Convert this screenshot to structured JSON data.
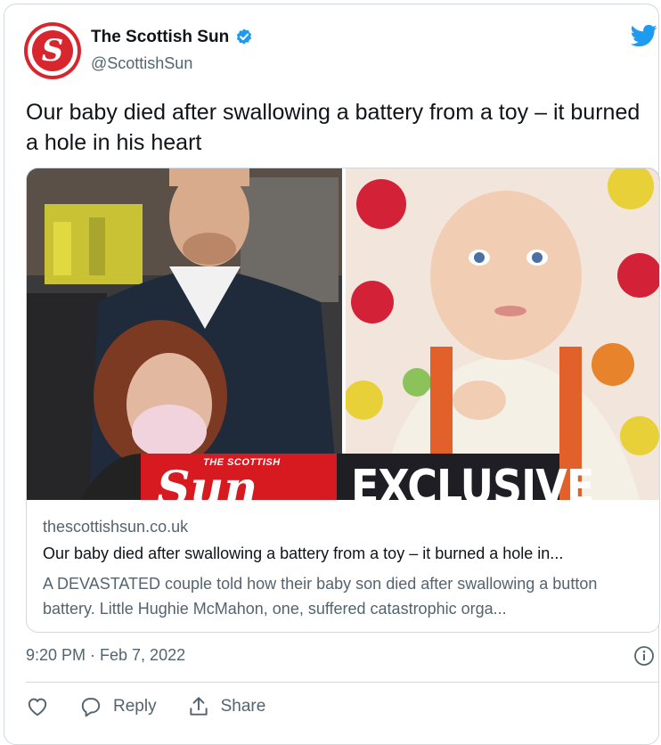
{
  "account": {
    "name": "The Scottish Sun",
    "handle": "@ScottishSun",
    "avatar_letter": "S",
    "brand_color": "#d8262e",
    "verified_color": "#1d9bf0"
  },
  "tweet": {
    "text": "Our baby died after swallowing a battery from a toy – it burned a hole in his heart"
  },
  "link_card": {
    "banner_small": "THE SCOTTISH",
    "banner_big": "Sun",
    "banner_exclusive": "EXCLUSIVE",
    "domain": "thescottishsun.co.uk",
    "title": "Our baby died after swallowing a battery from a toy – it burned a hole in...",
    "description": "A DEVASTATED couple told how their baby son died after swallowing a button battery. Little Hughie McMahon, one, suffered catastrophic orga..."
  },
  "meta": {
    "timestamp": "9:20 PM · Feb 7, 2022"
  },
  "actions": {
    "like_icon": "heart-icon",
    "reply_label": "Reply",
    "share_label": "Share"
  },
  "icons": {
    "logo": "twitter-bird-icon",
    "info": "info-icon"
  },
  "colors": {
    "twitter_blue": "#1d9bf0",
    "secondary_text": "#536471",
    "border": "#cfd9de"
  }
}
